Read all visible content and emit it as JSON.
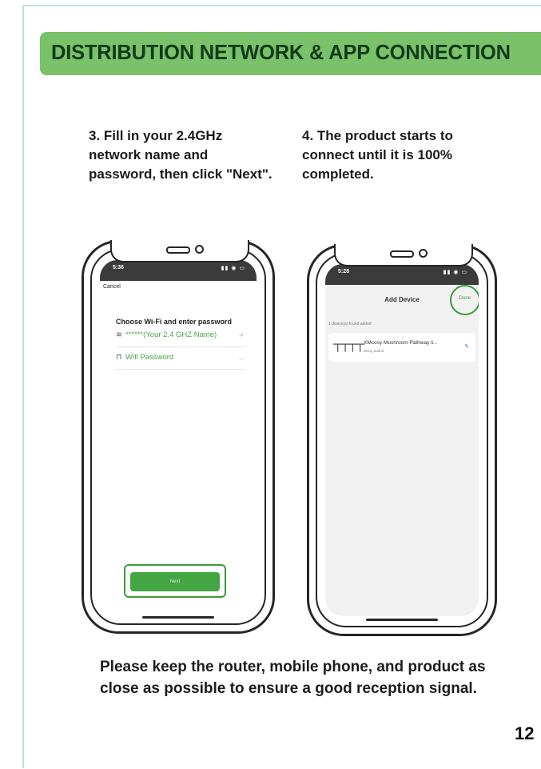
{
  "header": {
    "title": "DISTRIBUTION NETWORK & APP CONNECTION"
  },
  "steps": {
    "step3": "3. Fill in your 2.4GHz network name and password, then click \"Next\".",
    "step4": "4. The product starts to connect until it is 100% completed."
  },
  "phone1": {
    "time": "5:36",
    "cancel": "Cancel",
    "heading": "Choose Wi-Fi and enter password",
    "wifi_value": "******(Your 2.4 GHZ Name)",
    "password_placeholder": "Wifi Password",
    "next_label": "Next"
  },
  "phone2": {
    "time": "5:28",
    "title": "Add Device",
    "done": "Done",
    "added_count": "1 device(s) found added",
    "device_name": "XMcosy Mushroom Pathway li...",
    "device_status": "Being added"
  },
  "footer": {
    "note": "Please keep the router, mobile phone, and product as close as possible to ensure a good reception signal."
  },
  "page_number": "12",
  "colors": {
    "banner": "#79c26a",
    "accent_green": "#43a643",
    "frame": "#b9dfe6"
  }
}
